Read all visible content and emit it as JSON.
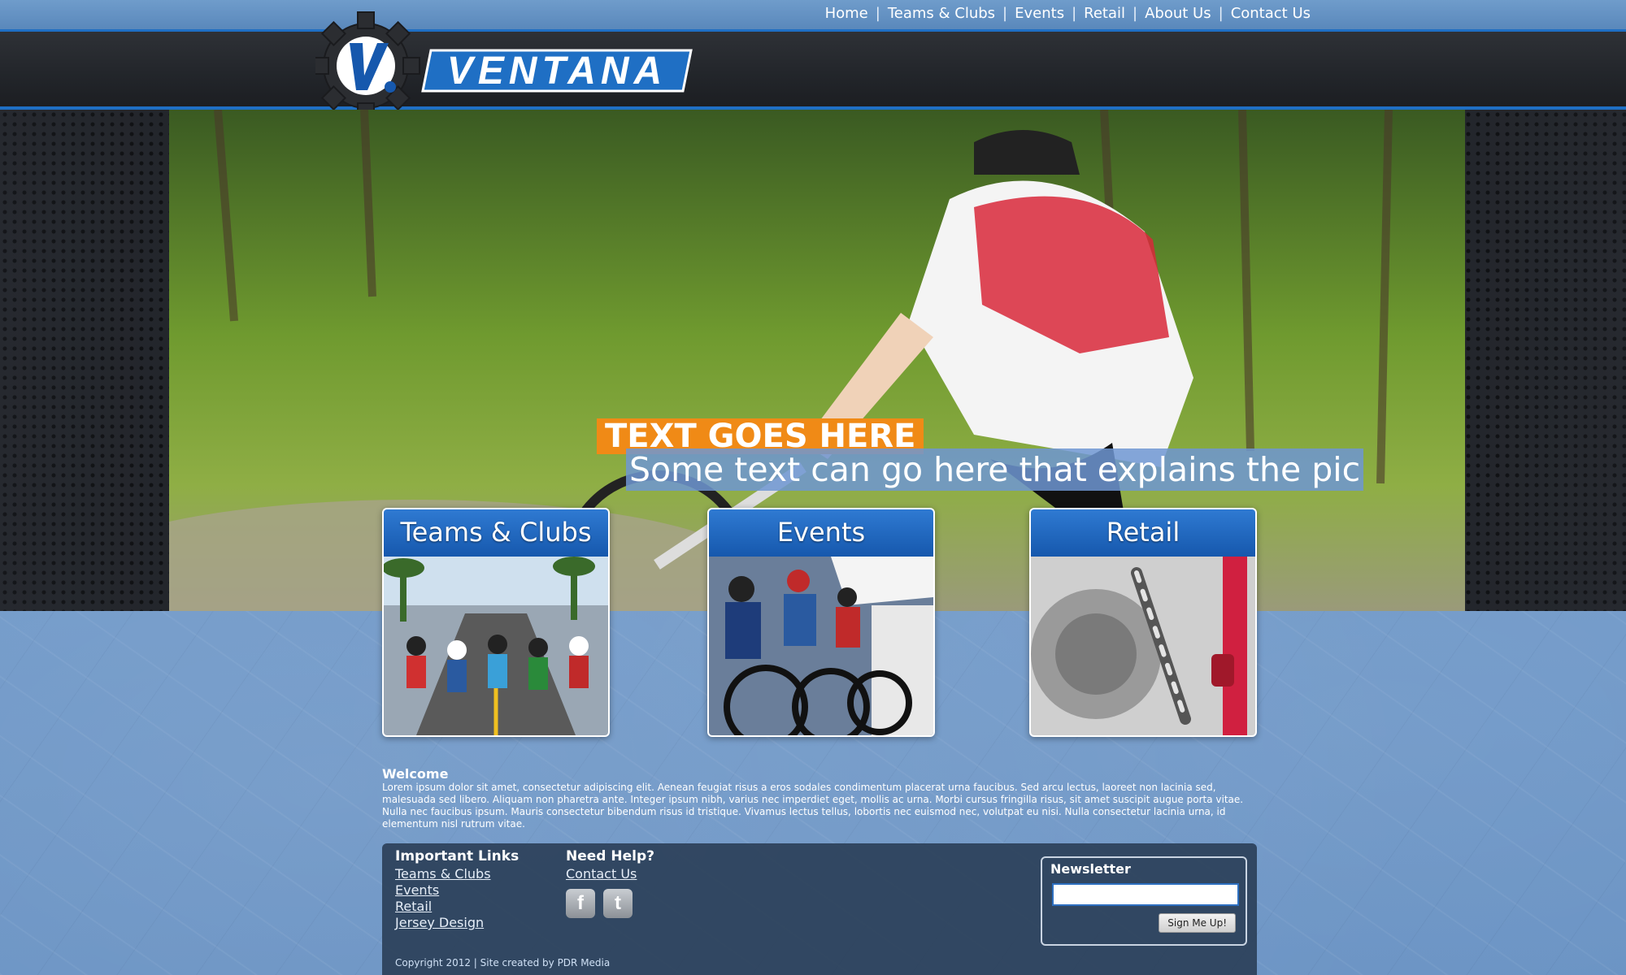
{
  "nav": {
    "items": [
      "Home",
      "Teams & Clubs",
      "Events",
      "Retail",
      "About Us",
      "Contact Us"
    ],
    "separator": "|"
  },
  "brand": {
    "name": "VENTANA",
    "mark": "V."
  },
  "hero": {
    "title": "TEXT GOES HERE",
    "subtitle": "Some text can go here that explains the pic"
  },
  "cards": [
    {
      "label": "Teams & Clubs"
    },
    {
      "label": "Events"
    },
    {
      "label": "Retail"
    }
  ],
  "welcome": {
    "title": "Welcome",
    "body": "Lorem ipsum dolor sit amet, consectetur adipiscing elit. Aenean feugiat risus a eros sodales condimentum placerat urna faucibus. Sed arcu lectus, laoreet non lacinia sed, malesuada sed libero. Aliquam non pharetra ante. Integer ipsum nibh, varius nec imperdiet eget, mollis ac urna. Morbi cursus fringilla risus, sit amet suscipit augue porta vitae. Nulla nec faucibus ipsum. Mauris consectetur bibendum risus id tristique. Vivamus lectus tellus, lobortis nec euismod nec, volutpat eu nisi. Nulla consectetur lacinia urna, id elementum nisl rutrum vitae."
  },
  "footer": {
    "links_title": "Important Links",
    "links": [
      "Teams & Clubs",
      "Events",
      "Retail",
      "Jersey Design"
    ],
    "help_title": "Need Help?",
    "help_link": "Contact Us",
    "social": {
      "facebook": "f",
      "twitter": "t"
    },
    "newsletter": {
      "title": "Newsletter",
      "input_value": "",
      "button": "Sign Me Up!"
    },
    "copyright": "Copyright 2012 | Site created by PDR Media"
  },
  "colors": {
    "accent": "#1f6fc4",
    "orange": "#f08a16",
    "header_dark": "#22252a"
  }
}
